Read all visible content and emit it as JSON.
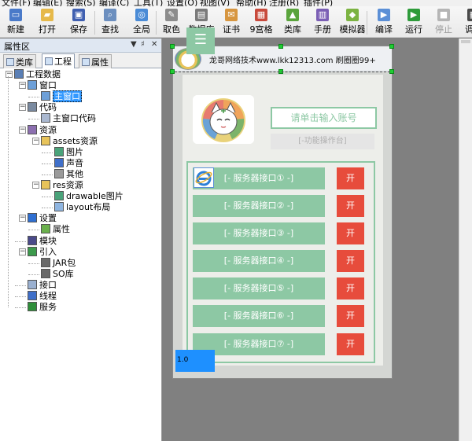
{
  "menubar": [
    "文件(F)",
    "编辑(E)",
    "搜索(S)",
    "编译(C)",
    "工具(T)",
    "设置(O)",
    "视图(V)",
    "帮助(H)",
    "注册(R)",
    "插件(P)"
  ],
  "toolbar": {
    "buttons": [
      {
        "label": "新建",
        "icon": "new-file-icon",
        "color": "#4a7ac9"
      },
      {
        "label": "打开",
        "icon": "folder-open-icon",
        "color": "#e6b94a"
      },
      {
        "label": "保存",
        "icon": "save-icon",
        "color": "#3f5fb0"
      },
      {
        "label": "查找",
        "icon": "search-icon",
        "color": "#6c8fbf"
      },
      {
        "label": "全局",
        "icon": "global-icon",
        "color": "#4a8bd6"
      },
      {
        "label": "取色",
        "icon": "color-picker-icon",
        "color": "#8c8c8c"
      },
      {
        "label": "数据库",
        "icon": "database-icon",
        "color": "#7a7a7a"
      },
      {
        "label": "证书",
        "icon": "certificate-icon",
        "color": "#d79640"
      },
      {
        "label": "9宫格",
        "icon": "grid-icon",
        "color": "#c84a3c"
      },
      {
        "label": "类库",
        "icon": "android-library-icon",
        "color": "#5aa43c"
      },
      {
        "label": "手册",
        "icon": "manual-icon",
        "color": "#7b5fb5"
      },
      {
        "label": "模拟器",
        "icon": "android-emulator-icon",
        "color": "#7cb342"
      },
      {
        "label": "编译",
        "icon": "compile-icon",
        "color": "#5b8fd6"
      },
      {
        "label": "运行",
        "icon": "run-icon",
        "color": "#2e9b3a"
      },
      {
        "label": "停止",
        "icon": "stop-icon",
        "color": "#b5b5b5"
      },
      {
        "label": "调试",
        "icon": "debug-icon",
        "color": "#4a4a4a"
      }
    ]
  },
  "panel": {
    "title": "属性区",
    "controls": [
      "▼",
      "♯",
      "✕"
    ],
    "tabs": [
      "类库",
      "工程",
      "属性"
    ],
    "active_tab": "工程"
  },
  "tree": [
    {
      "label": "工程数据",
      "level": 0,
      "icon": "project-icon"
    },
    {
      "label": "窗口",
      "level": 1,
      "icon": "window-icon"
    },
    {
      "label": "主窗口",
      "level": 2,
      "icon": "window-icon",
      "selected": true
    },
    {
      "label": "代码",
      "level": 1,
      "icon": "code-icon"
    },
    {
      "label": "主窗口代码",
      "level": 2,
      "icon": "code-file-icon"
    },
    {
      "label": "资源",
      "level": 1,
      "icon": "resource-icon"
    },
    {
      "label": "assets资源",
      "level": 2,
      "icon": "folder-icon"
    },
    {
      "label": "图片",
      "level": 3,
      "icon": "image-icon"
    },
    {
      "label": "声音",
      "level": 3,
      "icon": "music-icon"
    },
    {
      "label": "其他",
      "level": 3,
      "icon": "unknown-file-icon"
    },
    {
      "label": "res资源",
      "level": 2,
      "icon": "folder-icon"
    },
    {
      "label": "drawable图片",
      "level": 3,
      "icon": "image-icon"
    },
    {
      "label": "layout布局",
      "level": 3,
      "icon": "layout-icon"
    },
    {
      "label": "设置",
      "level": 1,
      "icon": "info-icon"
    },
    {
      "label": "属性",
      "level": 2,
      "icon": "gear-icon"
    },
    {
      "label": "模块",
      "level": 1,
      "icon": "module-icon"
    },
    {
      "label": "引入",
      "level": 1,
      "icon": "import-icon"
    },
    {
      "label": "JAR包",
      "level": 2,
      "icon": "jar-icon"
    },
    {
      "label": "SO库",
      "level": 2,
      "icon": "so-icon"
    },
    {
      "label": "接口",
      "level": 1,
      "icon": "interface-icon"
    },
    {
      "label": "线程",
      "level": 1,
      "icon": "thread-icon"
    },
    {
      "label": "服务",
      "level": 1,
      "icon": "service-icon"
    }
  ],
  "form": {
    "title": "龙哥网络技术www.lkk12313.com 刷圈圈99+",
    "menu_glyph": "☰",
    "account_placeholder": "请单击输入账号",
    "function_label": "[-功能操作台]",
    "servers": [
      "[- 服务器接口① -]",
      "[- 服务器接口② -]",
      "[- 服务器接口③ -]",
      "[- 服务器接口④ -]",
      "[- 服务器接口⑤ -]",
      "[- 服务器接口⑥ -]",
      "[- 服务器接口⑦ -]"
    ],
    "open_label": "开",
    "version": "1.0"
  },
  "colors": {
    "accent_green": "#8dc8a4",
    "open_red": "#e74c3c",
    "version_blue": "#1e90ff",
    "selection": "#3399ff"
  }
}
